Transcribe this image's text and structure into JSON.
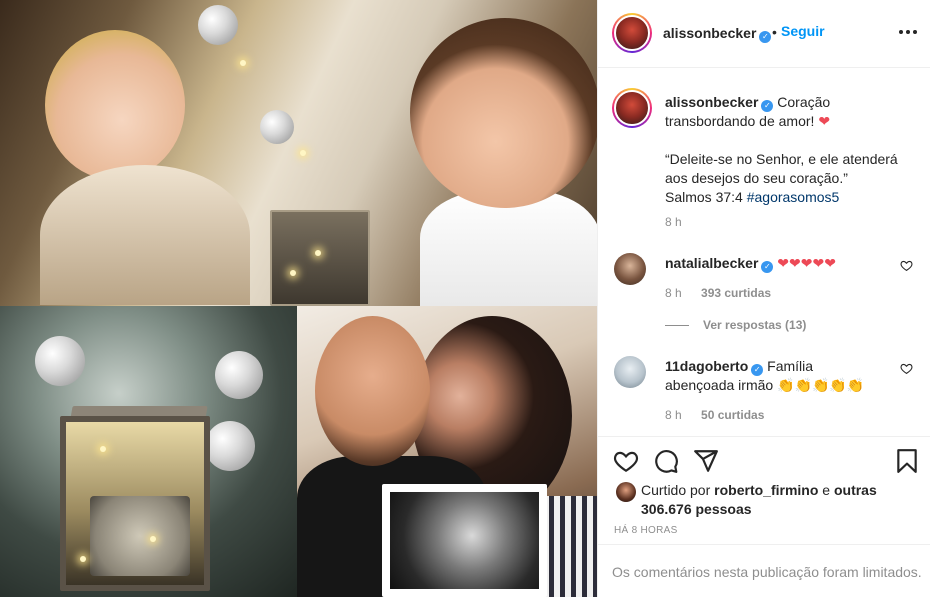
{
  "post": {
    "username": "alissonbecker",
    "verified_glyph": "✓",
    "separator": "•",
    "follow_label": "Seguir",
    "caption": {
      "username": "alissonbecker",
      "line1": "Coração transbordando de amor!",
      "heart": "❤",
      "quote": "“Deleite-se no Senhor, e ele atenderá aos desejos do seu coração.”",
      "ref": "Salmos 37:4",
      "hashtag": "#agorasomos5",
      "time": "8 h"
    },
    "comments": [
      {
        "username": "natalialbecker",
        "text": "❤❤❤❤❤",
        "time": "8 h",
        "likes": "393 curtidas",
        "replies": "Ver respostas (13)"
      },
      {
        "username": "11dagoberto",
        "text": "Família abençoada irmão 👏👏👏👏👏",
        "time": "8 h",
        "likes": "50 curtidas"
      }
    ],
    "liked_by": {
      "prefix": "Curtido por",
      "user": "roberto_firmino",
      "conj": "e",
      "others": "outras 306.676 pessoas"
    },
    "timestamp": "HÁ 8 HORAS",
    "comments_limited": "Os comentários nesta publicação foram limitados."
  },
  "icons": {
    "verified": "verified-badge-icon",
    "more": "more-options-icon",
    "like": "heart-icon",
    "comment": "comment-bubble-icon",
    "share": "paper-plane-icon",
    "save": "bookmark-icon"
  },
  "colors": {
    "accent": "#0095f6",
    "verified": "#3897f0",
    "hashtag": "#00376b",
    "heart": "#ed4956",
    "muted": "#8e8e8e"
  }
}
